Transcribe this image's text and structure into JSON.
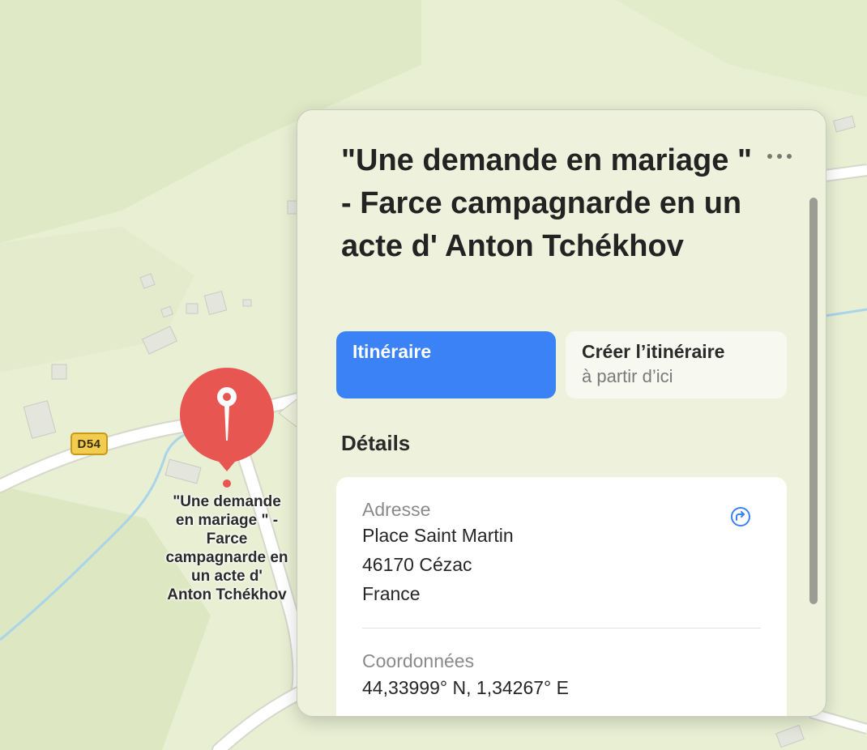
{
  "map": {
    "road_shield": "D54",
    "pin_label": "\"Une demande\nen mariage \" -\nFarce\ncampagnarde en\nun acte d'\nAnton Tchékhov"
  },
  "place": {
    "title": "\"Une demande en mariage \" - Farce campagnarde en un acte d' Anton Tchékhov"
  },
  "actions": {
    "directions_label": "Itinéraire",
    "create_route_line1": "Créer l’itinéraire",
    "create_route_line2": "à partir d’ici"
  },
  "details": {
    "section_title": "Détails",
    "address_label": "Adresse",
    "address_line1": "Place Saint Martin",
    "address_line2": "46170 Cézac",
    "address_line3": "France",
    "coordinates_label": "Coordonnées",
    "coordinates_value": "44,33999° N, 1,34267° E"
  },
  "icons": {
    "more": "ellipsis-icon",
    "share": "share-icon",
    "pin": "map-pin-icon"
  },
  "colors": {
    "accent_blue": "#3b82f6",
    "pin_red": "#e85652",
    "map_land": "#e8efd3",
    "road_shield": "#f2cc4e"
  }
}
